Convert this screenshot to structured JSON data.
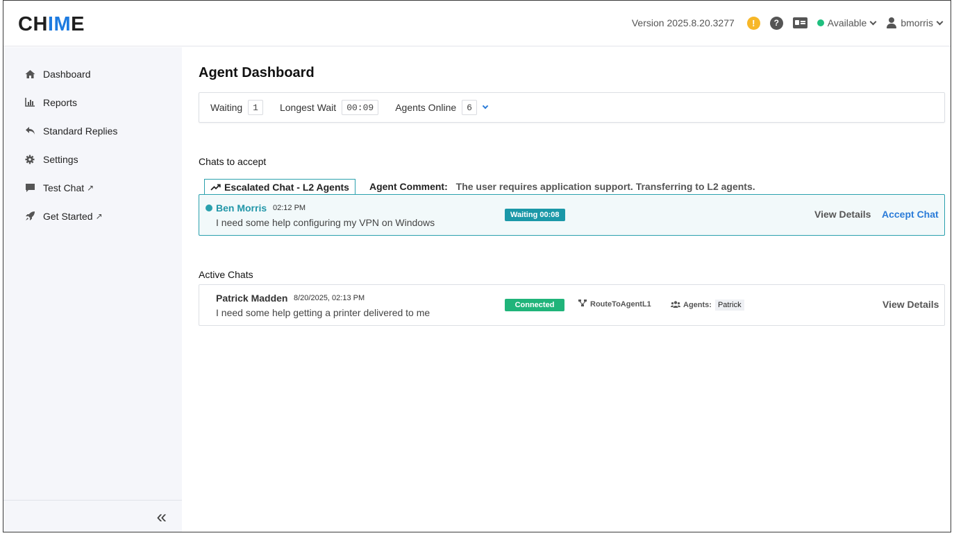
{
  "header": {
    "logo_pre": "CH",
    "logo_mid": "IM",
    "logo_post": "E",
    "version": "Version 2025.8.20.3277",
    "status": "Available",
    "username": "bmorris",
    "warn_glyph": "!",
    "help_glyph": "?"
  },
  "sidebar": {
    "items": [
      {
        "label": "Dashboard",
        "icon": "home-icon"
      },
      {
        "label": "Reports",
        "icon": "bar-chart-icon"
      },
      {
        "label": "Standard Replies",
        "icon": "reply-icon"
      },
      {
        "label": "Settings",
        "icon": "gear-icon"
      },
      {
        "label": "Test Chat",
        "icon": "comment-icon",
        "external": "↗"
      },
      {
        "label": "Get Started",
        "icon": "rocket-icon",
        "external": "↗"
      }
    ],
    "collapse_glyph": "«"
  },
  "main": {
    "title": "Agent Dashboard",
    "stats": {
      "waiting_label": "Waiting",
      "waiting_value": "1",
      "longest_wait_label": "Longest Wait",
      "longest_wait_value": "00:09",
      "agents_online_label": "Agents Online",
      "agents_online_value": "6"
    },
    "chats_to_accept": {
      "heading": "Chats to accept",
      "queue_tag": "Escalated Chat - L2 Agents",
      "agent_comment_label": "Agent Comment:",
      "agent_comment_text": "The user requires application support. Transferring to L2 agents.",
      "chat": {
        "name": "Ben Morris",
        "time": "02:12 PM",
        "message": "I need some help configuring my VPN on Windows",
        "badge": "Waiting 00:08",
        "view_details": "View Details",
        "accept": "Accept Chat"
      }
    },
    "active_chats": {
      "heading": "Active Chats",
      "chat": {
        "name": "Patrick Madden",
        "time": "8/20/2025, 02:13 PM",
        "message": "I need some help getting a printer delivered to me",
        "badge": "Connected",
        "route": "RouteToAgentL1",
        "agents_label": "Agents:",
        "agent_name": "Patrick",
        "view_details": "View Details"
      }
    }
  },
  "colors": {
    "brand_blue": "#1e7be0",
    "teal": "#2aa0ad",
    "available_green": "#1fbf7f",
    "connected_green": "#20b47a",
    "warn_yellow": "#f7b728",
    "link_blue": "#2a7bd8"
  }
}
